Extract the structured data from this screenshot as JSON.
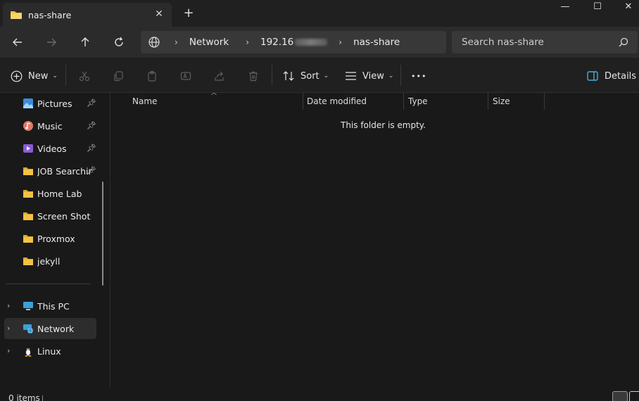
{
  "tab": {
    "title": "nas-share"
  },
  "window_controls": {
    "minimize": "—",
    "maximize": "☐",
    "close": "✕"
  },
  "address": {
    "crumbs": [
      "Network",
      "192.16",
      "nas-share"
    ]
  },
  "search": {
    "placeholder": "Search nas-share"
  },
  "commands": {
    "new_label": "New",
    "sort_label": "Sort",
    "view_label": "View",
    "more_label": "•••",
    "details_label": "Details"
  },
  "sidebar": {
    "items": [
      {
        "label": "Pictures",
        "icon": "pictures-icon",
        "pinned": true
      },
      {
        "label": "Music",
        "icon": "music-icon",
        "pinned": true
      },
      {
        "label": "Videos",
        "icon": "videos-icon",
        "pinned": true
      },
      {
        "label": "JOB Searching",
        "icon": "folder-icon",
        "pinned": true
      },
      {
        "label": "Home Lab",
        "icon": "folder-icon",
        "pinned": false
      },
      {
        "label": "Screen Shot",
        "icon": "folder-icon",
        "pinned": false
      },
      {
        "label": "Proxmox",
        "icon": "folder-icon",
        "pinned": false
      },
      {
        "label": "jekyll",
        "icon": "folder-icon",
        "pinned": false
      }
    ],
    "locations": [
      {
        "label": "This PC",
        "icon": "this-pc-icon"
      },
      {
        "label": "Network",
        "icon": "network-icon",
        "selected": true
      },
      {
        "label": "Linux",
        "icon": "linux-penguin-icon"
      }
    ]
  },
  "columns": [
    "Name",
    "Date modified",
    "Type",
    "Size"
  ],
  "empty_message": "This folder is empty.",
  "status": {
    "items": "0 items"
  },
  "colors": {
    "folder": "#f4c243",
    "accent": "#4cc2ff",
    "background": "#191919"
  }
}
